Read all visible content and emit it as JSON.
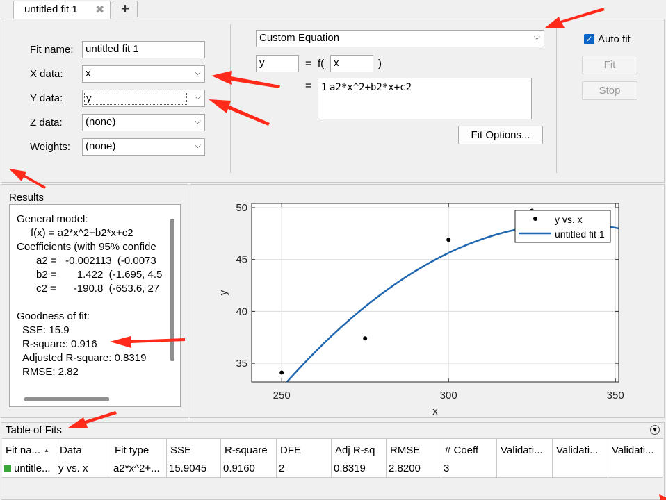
{
  "tabs": [
    {
      "label": "untitled fit 1",
      "close_glyph": "✖"
    }
  ],
  "add_tab_glyph": "+",
  "form": {
    "fit_name_label": "Fit name:",
    "fit_name_value": "untitled fit 1",
    "x_data_label": "X data:",
    "x_data_value": "x",
    "y_data_label": "Y data:",
    "y_data_value": "y",
    "z_data_label": "Z data:",
    "z_data_value": "(none)",
    "weights_label": "Weights:",
    "weights_value": "(none)"
  },
  "equation": {
    "type_value": "Custom Equation",
    "dependent": "y",
    "equals": "=",
    "f_label": "f(",
    "independent": "x",
    "close_paren": ")",
    "equals2": "=",
    "line_number": "1",
    "expression": "a2*x^2+b2*x+c2",
    "fit_options_label": "Fit Options..."
  },
  "controls": {
    "auto_fit_label": "Auto fit",
    "auto_fit_checked": true,
    "fit_label": "Fit",
    "stop_label": "Stop"
  },
  "results": {
    "title": "Results",
    "lines": [
      "General model:",
      "f(x) = a2*x^2+b2*x+c2",
      "Coefficients (with 95% confide",
      "a2 =   -0.002113  (-0.0073",
      "b2 =       1.422  (-1.695, 4.5",
      "c2 =      -190.8  (-653.6, 27",
      "",
      "Goodness of fit:",
      "SSE: 15.9",
      "R-square: 0.916",
      "Adjusted R-square: 0.8319",
      "RMSE: 2.82"
    ]
  },
  "chart_data": {
    "type": "scatter",
    "xlabel": "x",
    "ylabel": "y",
    "xlim": [
      241,
      351
    ],
    "ylim": [
      33.2,
      50.4
    ],
    "xticks": [
      250,
      300,
      350
    ],
    "yticks": [
      35,
      40,
      45,
      50
    ],
    "grid": true,
    "legend_position": "top-right",
    "series": [
      {
        "name": "y vs. x",
        "kind": "points",
        "color": "#000000",
        "x": [
          250,
          275,
          300,
          325
        ],
        "y": [
          34.1,
          37.4,
          46.9,
          49.7
        ]
      },
      {
        "name": "untitled fit 1",
        "kind": "line",
        "color": "#1f66b0",
        "coefficients": {
          "a2": -0.002113,
          "b2": 1.422,
          "c2": -190.8
        }
      }
    ]
  },
  "table": {
    "title": "Table of Fits",
    "columns": [
      "Fit na...",
      "Data",
      "Fit type",
      "SSE",
      "R-square",
      "DFE",
      "Adj R-sq",
      "RMSE",
      "# Coeff",
      "Validati...",
      "Validati...",
      "Validati..."
    ],
    "sort_indicator": "▲",
    "rows": [
      [
        "untitle...",
        "y vs. x",
        "a2*x^2+...",
        "15.9045",
        "0.9160",
        "2",
        "0.8319",
        "2.8200",
        "3",
        "",
        "",
        ""
      ]
    ],
    "row_color": "#3aa63a",
    "menu_glyph": "▾"
  },
  "colors": {
    "accent": "#0a64c8",
    "fit_line": "#1f66b0",
    "annotation_arrow": "#ff2a1a"
  }
}
